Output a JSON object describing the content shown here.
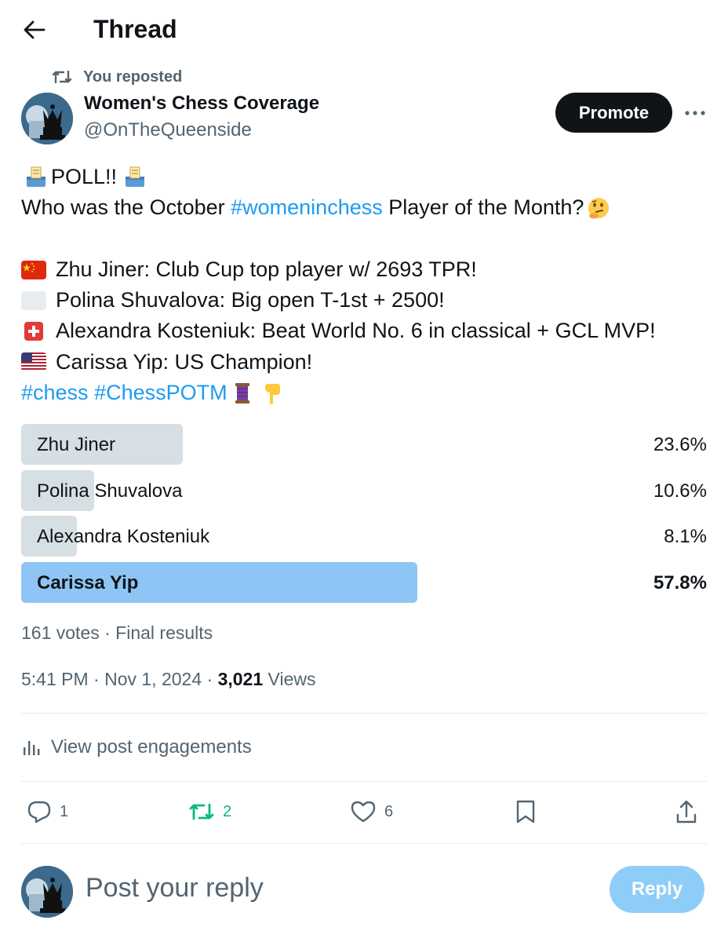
{
  "header": {
    "title": "Thread"
  },
  "repost": {
    "text": "You reposted"
  },
  "author": {
    "display_name": "Women's Chess Coverage",
    "handle": "@OnTheQueenside"
  },
  "promote": {
    "label": "Promote"
  },
  "post": {
    "line1": "POLL!!",
    "line2_pre": "Who was the October ",
    "line2_hashtag": "#womeninchess",
    "line2_post": " Player of the Month?",
    "candidates": [
      {
        "text": "Zhu Jiner: Club Cup top player w/ 2693 TPR!",
        "flag": "china-flag"
      },
      {
        "text": "Polina Shuvalova: Big open T-1st + 2500!",
        "flag": "blank-flag"
      },
      {
        "text": "Alexandra Kosteniuk: Beat World No. 6 in classical + GCL MVP!",
        "flag": "switzerland-flag"
      },
      {
        "text": "Carissa Yip: US Champion!",
        "flag": "usa-flag"
      }
    ],
    "tag1": "#chess",
    "tag2": "#ChessPOTM"
  },
  "poll": {
    "options": [
      {
        "label": "Zhu Jiner",
        "percent_text": "23.6%",
        "percent": 23.6
      },
      {
        "label": "Polina Shuvalova",
        "percent_text": "10.6%",
        "percent": 10.6
      },
      {
        "label": "Alexandra Kosteniuk",
        "percent_text": "8.1%",
        "percent": 8.1
      },
      {
        "label": "Carissa Yip",
        "percent_text": "57.8%",
        "percent": 57.8
      }
    ],
    "meta": "161 votes · Final results"
  },
  "timestamp": {
    "time": "5:41 PM · Nov 1, 2024 · ",
    "views_count": "3,021",
    "views_label": " Views"
  },
  "engagements": {
    "label": "View post engagements"
  },
  "actions": {
    "replies": "1",
    "reposts": "2",
    "likes": "6"
  },
  "reply_box": {
    "placeholder": "Post your reply",
    "button": "Reply"
  },
  "colors": {
    "accent": "#1d9bf0",
    "repost_green": "#00ba7c",
    "poll_winner": "#8ec5f4",
    "poll_other": "#cfd9de"
  }
}
